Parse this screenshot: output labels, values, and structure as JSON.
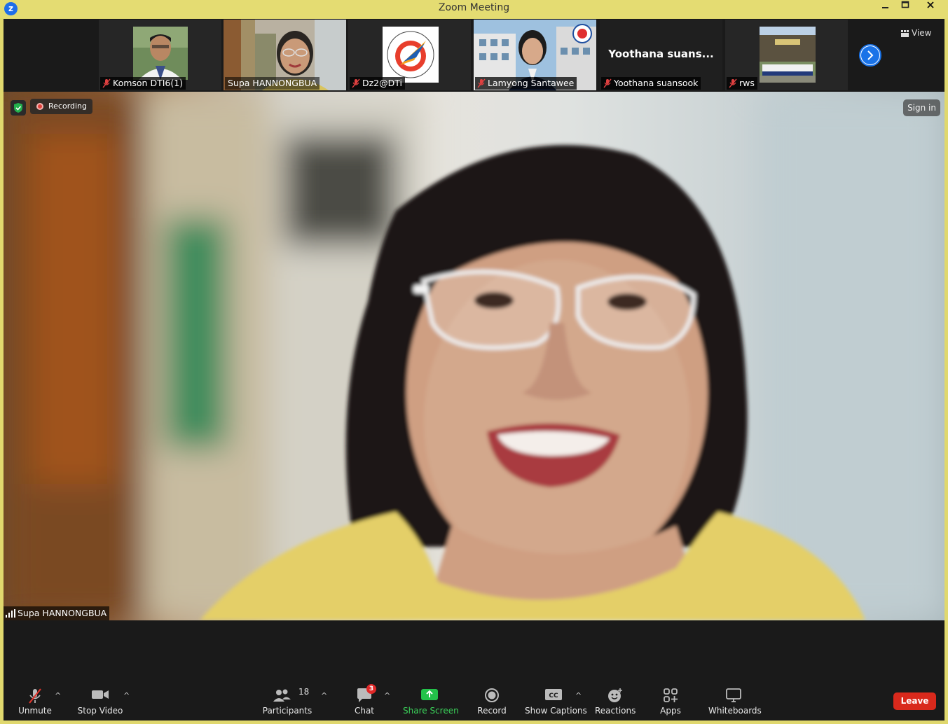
{
  "window": {
    "title": "Zoom Meeting"
  },
  "strip": {
    "view_label": "View",
    "tiles": [
      {
        "name": "Komson DTI6(1)",
        "muted": true
      },
      {
        "name": "Supa HANNONGBUA",
        "muted": false,
        "active": true
      },
      {
        "name": "Dz2@DTi",
        "muted": true
      },
      {
        "name": "Lamyong Santawee",
        "muted": true
      },
      {
        "name": "Yoothana suansook",
        "muted": true,
        "display_name": "Yoothana suans..."
      },
      {
        "name": "rws",
        "muted": true
      }
    ]
  },
  "main": {
    "recording_label": "Recording",
    "sign_in_label": "Sign in",
    "speaker_name": "Supa HANNONGBUA"
  },
  "toolbar": {
    "unmute": "Unmute",
    "stop_video": "Stop Video",
    "participants": "Participants",
    "participants_count": "18",
    "chat": "Chat",
    "chat_badge": "3",
    "share_screen": "Share Screen",
    "record": "Record",
    "show_captions": "Show Captions",
    "reactions": "Reactions",
    "apps": "Apps",
    "whiteboards": "Whiteboards",
    "leave": "Leave"
  },
  "colors": {
    "window_frame": "#e0d86e",
    "active_speaker_outline": "#c9e45f",
    "share_green": "#3bd35a",
    "leave_red": "#d9291c",
    "recording_red": "#e0413a",
    "accent_blue": "#1a73e8"
  }
}
